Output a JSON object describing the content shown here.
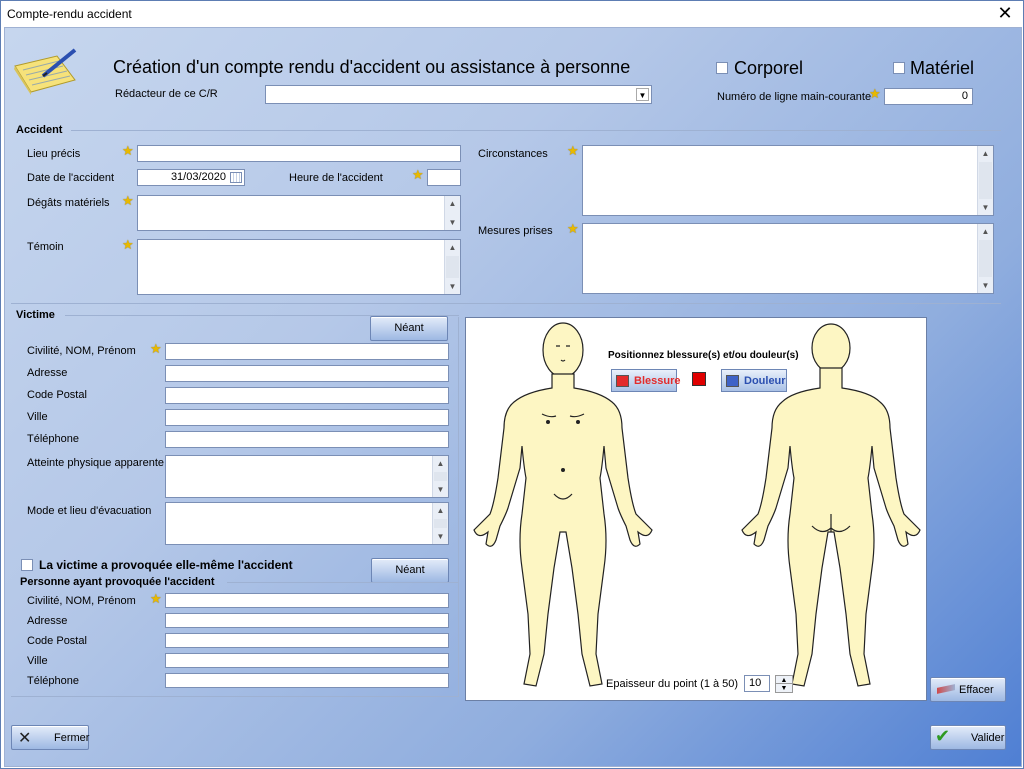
{
  "window": {
    "title": "Compte-rendu accident",
    "close_glyph": "✕"
  },
  "header": {
    "title": "Création d'un compte rendu d'accident ou assistance à personne",
    "redacteur_label": "Rédacteur de ce C/R",
    "redacteur_value": "",
    "corporel_label": "Corporel",
    "materiel_label": "Matériel",
    "ligne_label": "Numéro de ligne main-courante",
    "ligne_value": "0",
    "icon": "notepad-pen-icon"
  },
  "accident": {
    "group_label": "Accident",
    "lieu_label": "Lieu précis",
    "lieu_value": "",
    "date_label": "Date de l'accident",
    "date_value": "31/03/2020",
    "heure_label": "Heure de l'accident",
    "heure_value": "",
    "degats_label": "Dégâts matériels",
    "temoin_label": "Témoin",
    "circonstances_label": "Circonstances",
    "mesures_label": "Mesures prises"
  },
  "victime": {
    "group_label": "Victime",
    "neant_label": "Néant",
    "civilite_label": "Civilité, NOM, Prénom",
    "adresse_label": "Adresse",
    "cp_label": "Code Postal",
    "ville_label": "Ville",
    "tel_label": "Téléphone",
    "atteinte_label": "Atteinte physique apparente",
    "mode_label": "Mode et lieu d'évacuation"
  },
  "provoque": {
    "checkbox_label": "La victime a provoquée elle-même l'accident",
    "neant_label": "Néant",
    "group_label": "Personne ayant provoquée l'accident",
    "civilite_label": "Civilité, NOM, Prénom",
    "adresse_label": "Adresse",
    "cp_label": "Code Postal",
    "ville_label": "Ville",
    "tel_label": "Téléphone"
  },
  "body_panel": {
    "instruction": "Positionnez blessure(s) et/ou douleur(s)",
    "blessure_label": "Blessure",
    "douleur_label": "Douleur",
    "epaisseur_label": "Epaisseur du point (1 à 50)",
    "epaisseur_value": "10",
    "colors": {
      "blessure": "#e32b2b",
      "douleur": "#3f63c7",
      "selected": "#e00000",
      "skin": "#fdf6c3"
    }
  },
  "buttons": {
    "effacer": "Effacer",
    "fermer": "Fermer",
    "valider": "Valider"
  }
}
